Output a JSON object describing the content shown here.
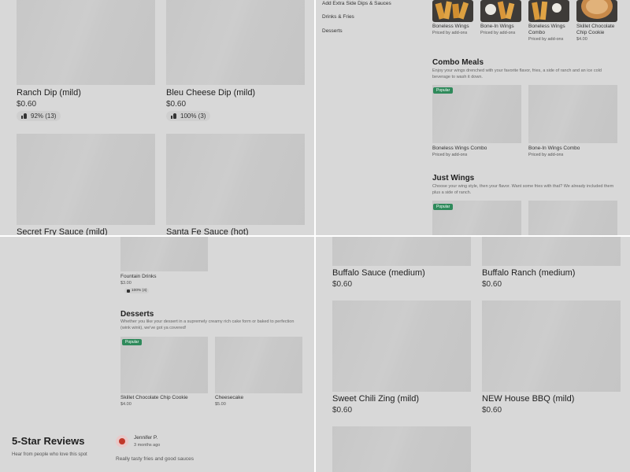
{
  "top_left": {
    "items": [
      {
        "name": "Ranch Dip (mild)",
        "price": "$0.60",
        "rating": "92% (13)"
      },
      {
        "name": "Bleu Cheese Dip (mild)",
        "price": "$0.60",
        "rating": "100% (3)"
      },
      {
        "name": "Secret Fry Sauce (mild)"
      },
      {
        "name": "Santa Fe Sauce (hot)"
      }
    ]
  },
  "top_right": {
    "nav": [
      "Add Extra Side Dips & Sauces",
      "Drinks & Fries",
      "Desserts"
    ],
    "featured": [
      {
        "name": "Boneless Wings",
        "price": "Priced by add-ons"
      },
      {
        "name": "Bone-In Wings",
        "price": "Priced by add-ons"
      },
      {
        "name": "Boneless Wings Combo",
        "price": "Priced by add-ons"
      },
      {
        "name": "Skillet Chocolate Chip Cookie",
        "price": "$4.00"
      }
    ],
    "combo": {
      "title": "Combo Meals",
      "description": "Enjoy your wings drenched with your favorite flavor, fries, a side of ranch and an ice cold beverage to wash it down.",
      "badge": "Popular",
      "items": [
        {
          "name": "Boneless Wings Combo",
          "price": "Priced by add-ons"
        },
        {
          "name": "Bone-In Wings Combo",
          "price": "Priced by add-ons"
        }
      ]
    },
    "just_wings": {
      "title": "Just Wings",
      "description": "Choose your wing style, then your flavor. Want some fries with that? We already included them plus a side of ranch.",
      "badge": "Popular"
    }
  },
  "bottom_left": {
    "fountain": {
      "name": "Fountain Drinks",
      "price": "$3.00",
      "rating": "100% (4)"
    },
    "desserts": {
      "title": "Desserts",
      "description": "Whether you like your dessert in a supremely creamy rich cake form or baked to perfection (wink wink), we've got ya covered!",
      "badge": "Popular",
      "items": [
        {
          "name": "Skillet Chocolate Chip Cookie",
          "price": "$4.00"
        },
        {
          "name": "Cheesecake",
          "price": "$5.00"
        }
      ]
    },
    "reviews": {
      "title": "5-Star Reviews",
      "subtitle": "Hear from people who love this spot",
      "reviewer": "Jennifer P.",
      "time": "3 months ago",
      "text": "Really tasty fries and good sauces"
    }
  },
  "bottom_right": {
    "items": [
      {
        "name": "Buffalo Sauce (medium)",
        "price": "$0.60"
      },
      {
        "name": "Buffalo Ranch (medium)",
        "price": "$0.60"
      },
      {
        "name": "Sweet Chili Zing (mild)",
        "price": "$0.60"
      },
      {
        "name": "NEW House BBQ (mild)",
        "price": "$0.60"
      }
    ]
  }
}
